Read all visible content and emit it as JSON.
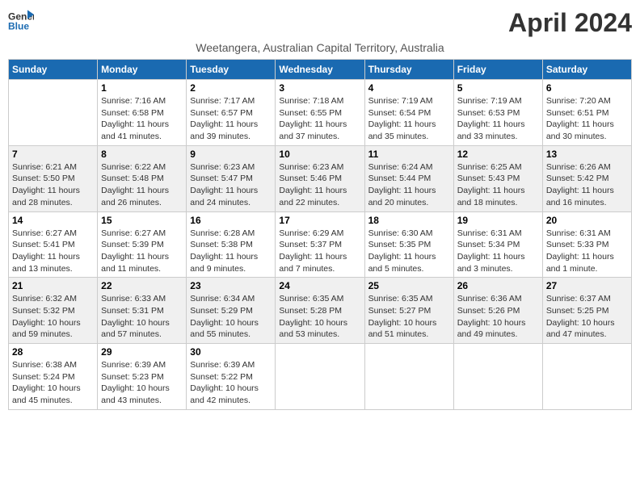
{
  "header": {
    "logo_line1": "General",
    "logo_line2": "Blue",
    "month_title": "April 2024",
    "subtitle": "Weetangera, Australian Capital Territory, Australia"
  },
  "weekdays": [
    "Sunday",
    "Monday",
    "Tuesday",
    "Wednesday",
    "Thursday",
    "Friday",
    "Saturday"
  ],
  "weeks": [
    [
      {
        "num": "",
        "info": ""
      },
      {
        "num": "1",
        "info": "Sunrise: 7:16 AM\nSunset: 6:58 PM\nDaylight: 11 hours\nand 41 minutes."
      },
      {
        "num": "2",
        "info": "Sunrise: 7:17 AM\nSunset: 6:57 PM\nDaylight: 11 hours\nand 39 minutes."
      },
      {
        "num": "3",
        "info": "Sunrise: 7:18 AM\nSunset: 6:55 PM\nDaylight: 11 hours\nand 37 minutes."
      },
      {
        "num": "4",
        "info": "Sunrise: 7:19 AM\nSunset: 6:54 PM\nDaylight: 11 hours\nand 35 minutes."
      },
      {
        "num": "5",
        "info": "Sunrise: 7:19 AM\nSunset: 6:53 PM\nDaylight: 11 hours\nand 33 minutes."
      },
      {
        "num": "6",
        "info": "Sunrise: 7:20 AM\nSunset: 6:51 PM\nDaylight: 11 hours\nand 30 minutes."
      }
    ],
    [
      {
        "num": "7",
        "info": "Sunrise: 6:21 AM\nSunset: 5:50 PM\nDaylight: 11 hours\nand 28 minutes."
      },
      {
        "num": "8",
        "info": "Sunrise: 6:22 AM\nSunset: 5:48 PM\nDaylight: 11 hours\nand 26 minutes."
      },
      {
        "num": "9",
        "info": "Sunrise: 6:23 AM\nSunset: 5:47 PM\nDaylight: 11 hours\nand 24 minutes."
      },
      {
        "num": "10",
        "info": "Sunrise: 6:23 AM\nSunset: 5:46 PM\nDaylight: 11 hours\nand 22 minutes."
      },
      {
        "num": "11",
        "info": "Sunrise: 6:24 AM\nSunset: 5:44 PM\nDaylight: 11 hours\nand 20 minutes."
      },
      {
        "num": "12",
        "info": "Sunrise: 6:25 AM\nSunset: 5:43 PM\nDaylight: 11 hours\nand 18 minutes."
      },
      {
        "num": "13",
        "info": "Sunrise: 6:26 AM\nSunset: 5:42 PM\nDaylight: 11 hours\nand 16 minutes."
      }
    ],
    [
      {
        "num": "14",
        "info": "Sunrise: 6:27 AM\nSunset: 5:41 PM\nDaylight: 11 hours\nand 13 minutes."
      },
      {
        "num": "15",
        "info": "Sunrise: 6:27 AM\nSunset: 5:39 PM\nDaylight: 11 hours\nand 11 minutes."
      },
      {
        "num": "16",
        "info": "Sunrise: 6:28 AM\nSunset: 5:38 PM\nDaylight: 11 hours\nand 9 minutes."
      },
      {
        "num": "17",
        "info": "Sunrise: 6:29 AM\nSunset: 5:37 PM\nDaylight: 11 hours\nand 7 minutes."
      },
      {
        "num": "18",
        "info": "Sunrise: 6:30 AM\nSunset: 5:35 PM\nDaylight: 11 hours\nand 5 minutes."
      },
      {
        "num": "19",
        "info": "Sunrise: 6:31 AM\nSunset: 5:34 PM\nDaylight: 11 hours\nand 3 minutes."
      },
      {
        "num": "20",
        "info": "Sunrise: 6:31 AM\nSunset: 5:33 PM\nDaylight: 11 hours\nand 1 minute."
      }
    ],
    [
      {
        "num": "21",
        "info": "Sunrise: 6:32 AM\nSunset: 5:32 PM\nDaylight: 10 hours\nand 59 minutes."
      },
      {
        "num": "22",
        "info": "Sunrise: 6:33 AM\nSunset: 5:31 PM\nDaylight: 10 hours\nand 57 minutes."
      },
      {
        "num": "23",
        "info": "Sunrise: 6:34 AM\nSunset: 5:29 PM\nDaylight: 10 hours\nand 55 minutes."
      },
      {
        "num": "24",
        "info": "Sunrise: 6:35 AM\nSunset: 5:28 PM\nDaylight: 10 hours\nand 53 minutes."
      },
      {
        "num": "25",
        "info": "Sunrise: 6:35 AM\nSunset: 5:27 PM\nDaylight: 10 hours\nand 51 minutes."
      },
      {
        "num": "26",
        "info": "Sunrise: 6:36 AM\nSunset: 5:26 PM\nDaylight: 10 hours\nand 49 minutes."
      },
      {
        "num": "27",
        "info": "Sunrise: 6:37 AM\nSunset: 5:25 PM\nDaylight: 10 hours\nand 47 minutes."
      }
    ],
    [
      {
        "num": "28",
        "info": "Sunrise: 6:38 AM\nSunset: 5:24 PM\nDaylight: 10 hours\nand 45 minutes."
      },
      {
        "num": "29",
        "info": "Sunrise: 6:39 AM\nSunset: 5:23 PM\nDaylight: 10 hours\nand 43 minutes."
      },
      {
        "num": "30",
        "info": "Sunrise: 6:39 AM\nSunset: 5:22 PM\nDaylight: 10 hours\nand 42 minutes."
      },
      {
        "num": "",
        "info": ""
      },
      {
        "num": "",
        "info": ""
      },
      {
        "num": "",
        "info": ""
      },
      {
        "num": "",
        "info": ""
      }
    ]
  ],
  "colors": {
    "header_bg": "#1a6ab1",
    "row_shaded": "#f0f0f0",
    "row_white": "#ffffff"
  }
}
